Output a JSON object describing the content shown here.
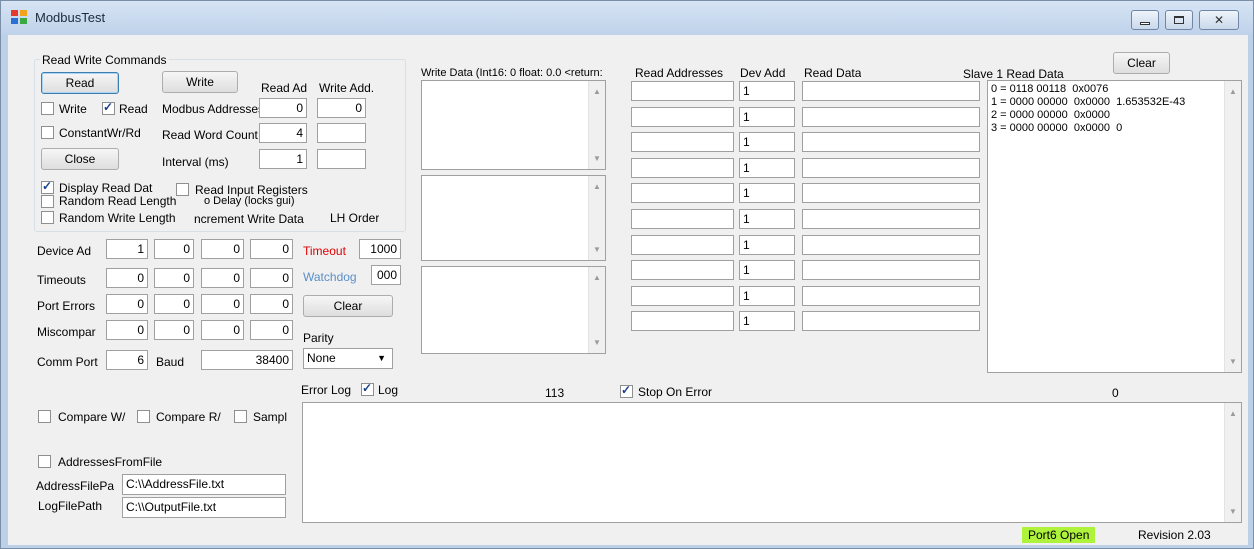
{
  "window": {
    "title": "ModbusTest"
  },
  "rw_group": {
    "title": "Read Write Commands",
    "read_btn": "Read",
    "write_btn": "Write",
    "read_ad_header": "Read Ad",
    "write_add_header": "Write Add.",
    "write_cb": "Write",
    "read_cb": "Read",
    "modbus_addresses_lbl": "Modbus Addresses",
    "read_addr_val": "0",
    "write_addr_val": "0",
    "constant_cb": "ConstantWr/Rd",
    "read_word_count_lbl": "Read Word Count",
    "read_word_count_val": "4",
    "close_btn": "Close",
    "interval_lbl": "Interval (ms)",
    "interval_val": "1",
    "display_read_cb": "Display Read Dat",
    "read_input_cb": "Read Input Registers",
    "random_read_cb": "Random Read Length",
    "no_delay_lbl": "o Delay (locks gui)",
    "random_write_cb": "Random Write Length",
    "increment_lbl": "ncrement Write Data",
    "lh_order_lbl": "LH Order"
  },
  "stats": {
    "rows": [
      {
        "label": "Device Ad",
        "values": [
          "1",
          "0",
          "0",
          "0"
        ]
      },
      {
        "label": "Timeouts",
        "values": [
          "0",
          "0",
          "0",
          "0"
        ]
      },
      {
        "label": "Port Errors",
        "values": [
          "0",
          "0",
          "0",
          "0"
        ]
      },
      {
        "label": "Miscompar",
        "values": [
          "0",
          "0",
          "0",
          "0"
        ]
      }
    ],
    "comm_port_lbl": "Comm Port",
    "comm_port_val": "6",
    "baud_lbl": "Baud",
    "baud_val": "38400"
  },
  "right_ctrls": {
    "timeout_lbl": "Timeout",
    "timeout_val": "1000",
    "watchdog_lbl": "Watchdog",
    "watchdog_val": "000",
    "clear_btn": "Clear",
    "parity_lbl": "Parity",
    "parity_val": "None",
    "error_log_lbl": "Error Log",
    "log_cb": "Log"
  },
  "write_data": {
    "header": "Write Data (Int16: 0 float: 0.0 <return:"
  },
  "addr_table": {
    "read_addresses_header": "Read Addresses",
    "dev_add_header": "Dev Add",
    "read_data_header": "Read Data",
    "dev_values": [
      "1",
      "1",
      "1",
      "1",
      "1",
      "1",
      "1",
      "1",
      "1",
      "1"
    ]
  },
  "slave": {
    "header": "Slave 1 Read Data",
    "clear_btn": "Clear",
    "lines": [
      "0 = 0118 00118  0x0076",
      "1 = 0000 00000  0x0000  1.653532E-43",
      "2 = 0000 00000  0x0000",
      "3 = 0000 00000  0x0000  0"
    ]
  },
  "mid_status": {
    "count": "113",
    "stop_on_error_cb": "Stop On Error",
    "right_count": "0"
  },
  "bottom_left": {
    "compare_w_cb": "Compare W/",
    "compare_r_cb": "Compare R/",
    "sample_cb": "Sampl",
    "addresses_from_file_cb": "AddressesFromFile",
    "address_file_lbl": "AddressFilePa",
    "address_file_val": "C:\\\\AddressFile.txt",
    "log_file_lbl": "LogFilePath",
    "log_file_val": "C:\\\\OutputFile.txt"
  },
  "statusbar": {
    "port_status": "Port6 Open",
    "revision": "Revision 2.03"
  },
  "colors": {
    "timeout_red": "#e00000",
    "watchdog_blue": "#5a8fc8",
    "port_green": "#aef23b"
  }
}
